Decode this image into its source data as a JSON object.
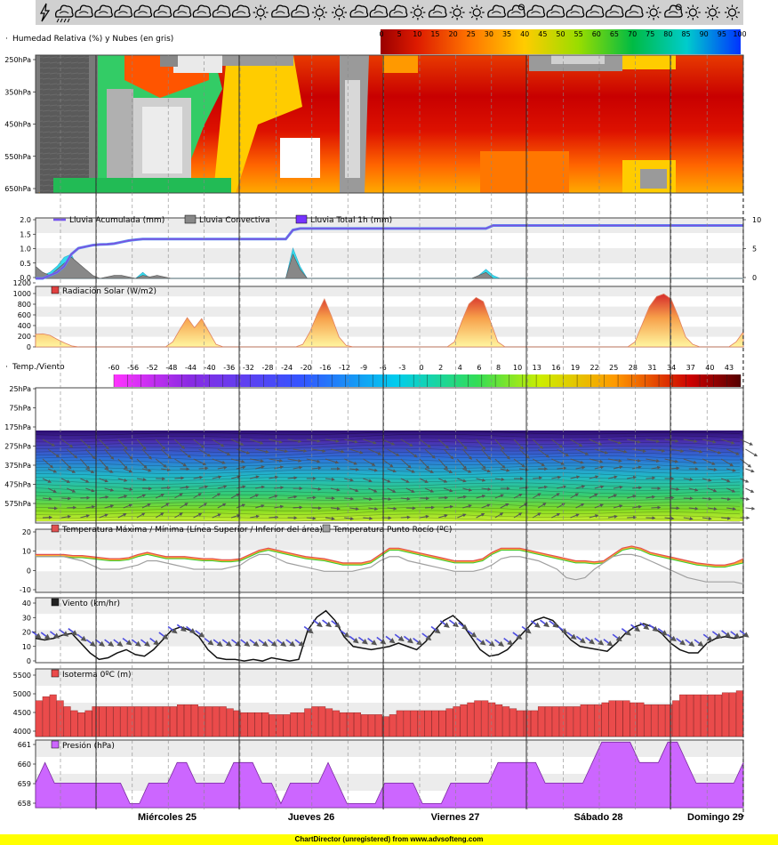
{
  "colors": {
    "dry": "#b40000",
    "mid": "#ff9900",
    "wet": "#00aa55",
    "cloud": "#888888",
    "accum": "#6f4fe0",
    "conv": "#888888",
    "total": "#7733ff",
    "solar": "#e04040",
    "tmax": "#e05050",
    "dew": "#a0a0a0",
    "wind": "#111111",
    "iso": "#ea4b4b",
    "pres": "#cc66ff"
  },
  "weather_icons": [
    "lightning-icon",
    "rain-cloud-icon",
    "cloudy-icon",
    "cloudy-icon",
    "cloudy-icon",
    "cloudy-icon",
    "cloudy-icon",
    "cloudy-icon",
    "cloudy-icon",
    "cloudy-icon",
    "cloudy-icon",
    "sun-icon",
    "cloudy-icon",
    "cloudy-icon",
    "sun-icon",
    "sun-icon",
    "cloudy-icon",
    "cloudy-icon",
    "cloudy-icon",
    "sun-icon",
    "cloudy-icon",
    "sun-icon",
    "sun-icon",
    "cloudy-icon",
    "partly-cloudy-icon",
    "cloudy-icon",
    "cloudy-icon",
    "cloudy-icon",
    "cloudy-icon",
    "cloudy-icon",
    "cloudy-icon",
    "sun-icon",
    "partly-cloudy-icon",
    "sun-icon",
    "sun-icon",
    "sun-icon"
  ],
  "days": [
    "Miércoles 25",
    "Jueves 26",
    "Viernes 27",
    "Sábado 28",
    "Domingo 29"
  ],
  "footer": "ChartDirector (unregistered) from www.advsofteng.com",
  "chart_data": [
    {
      "type": "heatmap",
      "title": "Humedad Relativa (%) y Nubes (en gris)",
      "scale_labels": [
        "0",
        "5",
        "10",
        "15",
        "20",
        "25",
        "30",
        "35",
        "40",
        "45",
        "50",
        "55",
        "60",
        "65",
        "70",
        "75",
        "80",
        "85",
        "90",
        "95",
        "100"
      ],
      "y_ticks": [
        "250hPa",
        "350hPa",
        "450hPa",
        "550hPa",
        "650hPa"
      ]
    },
    {
      "type": "area",
      "legend": [
        "Lluvia Acumulada (mm)",
        "Lluvia Convectiva",
        "Lluvia Total 1h (mm)"
      ],
      "y_ticks": [
        "2.0",
        "1.5",
        "1.0",
        "0.5",
        "0.0"
      ],
      "y2_ticks": [
        "10",
        "5",
        "0"
      ],
      "ylim": [
        0,
        2
      ],
      "y2lim": [
        0,
        10
      ],
      "accum": [
        0,
        0,
        0.1,
        0.2,
        0.4,
        0.8,
        1.0,
        1.05,
        1.1,
        1.12,
        1.13,
        1.15,
        1.2,
        1.25,
        1.28,
        1.3,
        1.3,
        1.3,
        1.3,
        1.3,
        1.3,
        1.3,
        1.3,
        1.3,
        1.3,
        1.3,
        1.3,
        1.3,
        1.3,
        1.3,
        1.3,
        1.3,
        1.3,
        1.3,
        1.3,
        1.3,
        1.6,
        1.65,
        1.65,
        1.65,
        1.65,
        1.65,
        1.65,
        1.65,
        1.65,
        1.65,
        1.65,
        1.65,
        1.65,
        1.65,
        1.65,
        1.65,
        1.65,
        1.65,
        1.65,
        1.65,
        1.65,
        1.65,
        1.65,
        1.65,
        1.65,
        1.65,
        1.65,
        1.65,
        1.75,
        1.75,
        1.75,
        1.75,
        1.75,
        1.75,
        1.75,
        1.75,
        1.75,
        1.75,
        1.75,
        1.75,
        1.75,
        1.75,
        1.75,
        1.75,
        1.75,
        1.75,
        1.75,
        1.75,
        1.75,
        1.75,
        1.75,
        1.75,
        1.75,
        1.75,
        1.75,
        1.75,
        1.75,
        1.75,
        1.75,
        1.75,
        1.75,
        1.75,
        1.75,
        1.75
      ],
      "convective": [
        0.4,
        0.2,
        0.1,
        0.3,
        0.5,
        0.7,
        0.5,
        0.3,
        0.1,
        0,
        0.05,
        0.1,
        0.1,
        0.05,
        0,
        0.1,
        0.05,
        0.1,
        0.05,
        0,
        0,
        0,
        0,
        0,
        0,
        0,
        0,
        0,
        0,
        0,
        0,
        0,
        0,
        0,
        0,
        0,
        0.8,
        0.3,
        0,
        0,
        0,
        0,
        0,
        0,
        0,
        0,
        0,
        0,
        0,
        0,
        0,
        0,
        0,
        0,
        0,
        0,
        0,
        0,
        0,
        0,
        0,
        0,
        0.1,
        0.2,
        0,
        0,
        0,
        0,
        0,
        0,
        0,
        0,
        0,
        0,
        0,
        0,
        0,
        0,
        0,
        0,
        0,
        0,
        0,
        0,
        0,
        0,
        0,
        0,
        0,
        0,
        0,
        0,
        0,
        0,
        0,
        0,
        0,
        0,
        0,
        0
      ],
      "total": [
        0.1,
        0.1,
        0.2,
        0.4,
        0.7,
        0.8,
        0.3,
        0.1,
        0,
        0,
        0,
        0,
        0,
        0,
        0,
        0.2,
        0,
        0,
        0,
        0,
        0,
        0,
        0,
        0,
        0,
        0,
        0,
        0,
        0,
        0,
        0,
        0,
        0,
        0,
        0,
        0,
        1.0,
        0.4,
        0,
        0,
        0,
        0,
        0,
        0,
        0,
        0,
        0,
        0,
        0,
        0,
        0,
        0,
        0,
        0,
        0,
        0,
        0,
        0,
        0,
        0,
        0,
        0,
        0.1,
        0.3,
        0.1,
        0,
        0,
        0,
        0,
        0,
        0,
        0,
        0,
        0,
        0,
        0,
        0,
        0,
        0,
        0,
        0,
        0,
        0,
        0,
        0,
        0,
        0,
        0,
        0,
        0,
        0,
        0,
        0,
        0,
        0,
        0,
        0,
        0,
        0,
        0
      ]
    },
    {
      "type": "area",
      "title": "Radiación Solar (W/m2)",
      "y_ticks": [
        "1200",
        "1000",
        "800",
        "600",
        "400",
        "200",
        "0"
      ],
      "ylim": [
        0,
        1200
      ],
      "values": [
        250,
        260,
        230,
        150,
        80,
        20,
        0,
        0,
        0,
        0,
        0,
        0,
        0,
        0,
        0,
        0,
        0,
        0,
        0,
        100,
        350,
        580,
        380,
        560,
        300,
        50,
        0,
        0,
        0,
        0,
        0,
        0,
        0,
        0,
        0,
        0,
        0,
        50,
        300,
        650,
        950,
        600,
        200,
        30,
        0,
        0,
        0,
        0,
        0,
        0,
        0,
        0,
        0,
        0,
        0,
        0,
        0,
        0,
        100,
        500,
        850,
        980,
        900,
        500,
        100,
        0,
        0,
        0,
        0,
        0,
        0,
        0,
        0,
        0,
        0,
        0,
        0,
        0,
        0,
        0,
        0,
        0,
        0,
        100,
        450,
        800,
        1000,
        1050,
        950,
        600,
        200,
        50,
        0,
        0,
        0,
        0,
        0,
        100,
        300
      ]
    },
    {
      "type": "heatmap",
      "title": "Temp./Viento",
      "scale_labels": [
        "-60",
        "-56",
        "-52",
        "-48",
        "-44",
        "-40",
        "-36",
        "-32",
        "-28",
        "-24",
        "-20",
        "-16",
        "-12",
        "-9",
        "-6",
        "-3",
        "0",
        "2",
        "4",
        "6",
        "8",
        "10",
        "13",
        "16",
        "19",
        "22",
        "25",
        "28",
        "31",
        "34",
        "37",
        "40",
        "43"
      ],
      "y_ticks": [
        "25hPa",
        "75hPa",
        "175hPa",
        "275hPa",
        "375hPa",
        "475hPa",
        "575hPa"
      ]
    },
    {
      "type": "line",
      "legend": [
        "Temperatura Máxima / Mínima (Línea Superior / Inferior del área)",
        "Temperatura Punto Rocío (ºC)"
      ],
      "y_ticks": [
        "20",
        "10",
        "0",
        "-10"
      ],
      "ylim": [
        -10,
        20
      ],
      "tmax": [
        8,
        8,
        8,
        8,
        7.5,
        7.5,
        7,
        6.5,
        6,
        6,
        6.5,
        8,
        9,
        8,
        7,
        7,
        7,
        6.5,
        6,
        6,
        5.5,
        5.5,
        6,
        8,
        10,
        11,
        10,
        9,
        8,
        7,
        6.5,
        6,
        5,
        4,
        4,
        4,
        5,
        8,
        11,
        11,
        10,
        9,
        8,
        7,
        6,
        5,
        5,
        5,
        6,
        9,
        11,
        11,
        11,
        10,
        9,
        8,
        7,
        6,
        5,
        5,
        4.5,
        5,
        8,
        11,
        12,
        11,
        9,
        8,
        7,
        6,
        5,
        4,
        3.5,
        3,
        3,
        4,
        6
      ],
      "tmin": [
        7,
        7,
        7,
        7,
        6.5,
        6.5,
        6,
        5.5,
        5,
        5,
        5.5,
        7,
        8,
        7,
        6,
        6,
        6,
        5.5,
        5,
        5,
        4.5,
        4.5,
        5,
        7,
        9,
        10,
        9,
        8,
        7,
        6,
        5.5,
        5,
        4,
        3,
        3,
        3,
        4,
        7,
        10,
        10,
        9,
        8,
        7,
        6,
        5,
        4,
        4,
        4,
        5,
        8,
        10,
        10,
        10,
        9,
        8,
        7,
        6,
        5,
        4,
        4,
        3.5,
        4,
        7,
        10,
        11,
        10,
        8,
        7,
        6,
        5,
        4,
        3,
        2.5,
        2,
        2,
        3,
        4
      ],
      "dew": [
        7,
        7,
        7,
        7,
        6,
        5,
        3,
        1,
        1,
        1,
        2,
        3,
        5,
        5,
        4,
        3,
        2,
        1,
        1,
        1,
        1,
        2,
        3,
        6,
        8,
        8,
        6,
        4,
        3,
        2,
        1,
        0,
        0,
        0,
        0,
        1,
        2,
        5,
        7,
        7,
        5,
        4,
        3,
        2,
        1,
        0,
        0,
        0,
        1,
        3,
        6,
        7,
        7,
        6,
        5,
        3,
        1,
        -3,
        -4,
        -3,
        1,
        4,
        7,
        8,
        8,
        7,
        5,
        3,
        1,
        -1,
        -3,
        -4,
        -5,
        -5,
        -5,
        -5,
        -6
      ]
    },
    {
      "type": "line",
      "title": "Viento (km/hr)",
      "y_ticks": [
        "40",
        "30",
        "20",
        "10",
        "0"
      ],
      "ylim": [
        0,
        40
      ],
      "values": [
        15,
        14,
        15,
        17,
        18,
        12,
        6,
        2,
        3,
        6,
        8,
        5,
        4,
        8,
        14,
        20,
        22,
        20,
        16,
        8,
        3,
        2,
        2,
        1,
        2,
        1,
        3,
        2,
        1,
        2,
        20,
        28,
        32,
        26,
        16,
        10,
        9,
        8,
        9,
        10,
        12,
        10,
        8,
        13,
        20,
        26,
        29,
        24,
        16,
        8,
        4,
        5,
        8,
        14,
        20,
        26,
        28,
        26,
        20,
        14,
        10,
        9,
        8,
        7,
        12,
        18,
        22,
        24,
        22,
        18,
        12,
        8,
        6,
        6,
        12,
        15,
        16,
        15,
        16
      ]
    },
    {
      "type": "bar",
      "title": "Isoterma 0ºC (m)",
      "y_ticks": [
        "5500",
        "5000",
        "4500",
        "4000"
      ],
      "ylim": [
        3900,
        5600
      ],
      "values": [
        4800,
        4900,
        4950,
        4800,
        4650,
        4550,
        4500,
        4550,
        4650,
        4650,
        4650,
        4650,
        4650,
        4650,
        4650,
        4650,
        4650,
        4650,
        4650,
        4650,
        4700,
        4700,
        4700,
        4650,
        4650,
        4650,
        4650,
        4600,
        4550,
        4500,
        4500,
        4500,
        4500,
        4450,
        4450,
        4450,
        4500,
        4500,
        4600,
        4650,
        4650,
        4600,
        4550,
        4500,
        4500,
        4500,
        4450,
        4450,
        4450,
        4400,
        4450,
        4550,
        4550,
        4550,
        4550,
        4550,
        4550,
        4550,
        4600,
        4650,
        4700,
        4750,
        4800,
        4800,
        4750,
        4700,
        4650,
        4600,
        4550,
        4550,
        4550,
        4650,
        4650,
        4650,
        4650,
        4650,
        4650,
        4700,
        4700,
        4700,
        4750,
        4800,
        4800,
        4800,
        4750,
        4750,
        4700,
        4700,
        4700,
        4700,
        4800,
        4950,
        4950,
        4950,
        4950,
        4950,
        4950,
        5000,
        5000,
        5050
      ]
    },
    {
      "type": "area",
      "title": "Presión (hPa)",
      "y_ticks": [
        "661",
        "660",
        "659",
        "658"
      ],
      "ylim": [
        657.8,
        661.1
      ],
      "values": [
        659,
        660,
        659,
        659,
        659,
        659,
        659,
        659,
        659,
        659,
        658,
        658,
        659,
        659,
        659,
        660,
        660,
        659,
        659,
        659,
        659,
        660,
        660,
        660,
        659,
        659,
        658,
        659,
        659,
        659,
        659,
        660,
        659,
        658,
        658,
        658,
        658,
        659,
        659,
        659,
        659,
        658,
        658,
        658,
        659,
        659,
        659,
        659,
        659,
        660,
        660,
        660,
        660,
        660,
        659,
        659,
        659,
        659,
        659,
        660,
        661,
        661,
        661,
        661,
        660,
        660,
        660,
        661,
        661,
        660,
        659,
        659,
        659,
        659,
        659,
        660
      ]
    }
  ]
}
